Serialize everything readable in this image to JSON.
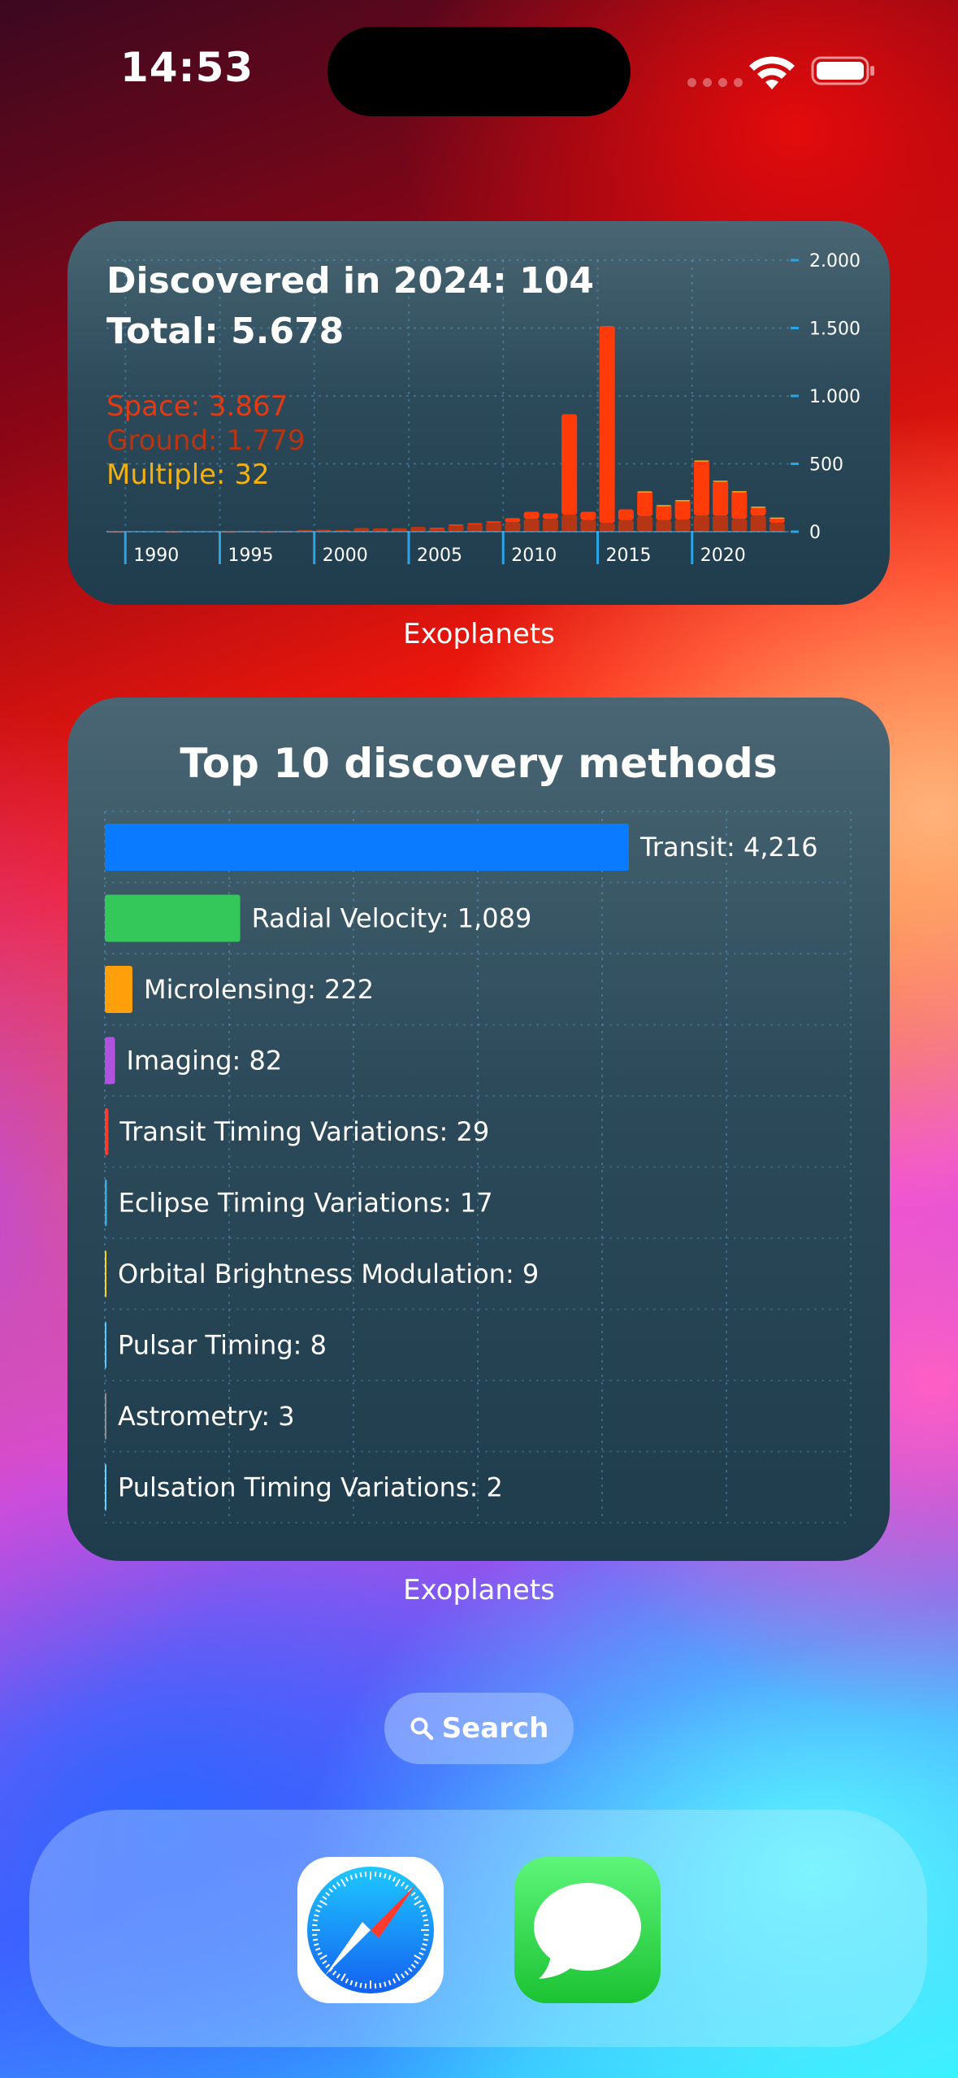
{
  "status_bar": {
    "time": "14:53"
  },
  "widget_top": {
    "line1": "Discovered in 2024: 104",
    "line2": "Total: 5.678",
    "space": "Space: 3.867",
    "ground": "Ground: 1.779",
    "multiple": "Multiple: 32",
    "label": "Exoplanets",
    "colors": {
      "space": "#ff3b0a",
      "ground": "#b53614",
      "multiple": "#f2b011"
    },
    "chart_data": {
      "type": "bar",
      "x": [
        1989,
        1990,
        1991,
        1992,
        1993,
        1994,
        1995,
        1996,
        1997,
        1998,
        1999,
        2000,
        2001,
        2002,
        2003,
        2004,
        2005,
        2006,
        2007,
        2008,
        2009,
        2010,
        2011,
        2012,
        2013,
        2014,
        2015,
        2016,
        2017,
        2018,
        2019,
        2020,
        2021,
        2022,
        2023,
        2024
      ],
      "series": [
        {
          "name": "Space",
          "values": [
            0,
            0,
            0,
            0,
            0,
            0,
            0,
            0,
            0,
            0,
            0,
            0,
            0,
            0,
            0,
            0,
            0,
            1,
            4,
            7,
            10,
            30,
            52,
            40,
            740,
            60,
            1450,
            80,
            180,
            110,
            140,
            400,
            250,
            200,
            60,
            35
          ]
        },
        {
          "name": "Ground",
          "values": [
            1,
            0,
            0,
            1,
            0,
            0,
            1,
            6,
            1,
            6,
            13,
            15,
            12,
            28,
            25,
            26,
            36,
            28,
            50,
            56,
            66,
            70,
            95,
            95,
            125,
            87,
            65,
            85,
            115,
            85,
            90,
            120,
            120,
            95,
            120,
            65
          ]
        },
        {
          "name": "Multiple",
          "values": [
            0,
            0,
            0,
            0,
            0,
            0,
            0,
            0,
            0,
            0,
            0,
            0,
            0,
            0,
            0,
            0,
            0,
            0,
            0,
            0,
            0,
            0,
            0,
            0,
            0,
            0,
            0,
            0,
            2,
            1,
            3,
            5,
            6,
            4,
            5,
            4
          ]
        }
      ],
      "x_ticks": [
        "1990",
        "1995",
        "2000",
        "2005",
        "2010",
        "2015",
        "2020"
      ],
      "y_ticks": [
        "2.000",
        "1.500",
        "1.000",
        "500",
        "0"
      ],
      "ylim": [
        0,
        2000
      ],
      "grid": true
    }
  },
  "widget_bottom": {
    "title": "Top 10 discovery methods",
    "label": "Exoplanets",
    "chart_data": {
      "type": "bar",
      "orientation": "horizontal",
      "categories": [
        "Transit",
        "Radial Velocity",
        "Microlensing",
        "Imaging",
        "Transit Timing Variations",
        "Eclipse Timing Variations",
        "Orbital Brightness Modulation",
        "Pulsar Timing",
        "Astrometry",
        "Pulsation Timing Variations"
      ],
      "values": [
        4216,
        1089,
        222,
        82,
        29,
        17,
        9,
        8,
        3,
        2
      ],
      "value_labels": [
        "Transit: 4,216",
        "Radial Velocity: 1,089",
        "Microlensing: 222",
        "Imaging: 82",
        "Transit Timing Variations: 29",
        "Eclipse Timing Variations: 17",
        "Orbital Brightness Modulation: 9",
        "Pulsar Timing: 8",
        "Astrometry: 3",
        "Pulsation Timing Variations: 2"
      ],
      "colors": [
        "#0a7bff",
        "#34c759",
        "#ff9f0a",
        "#af52de",
        "#ff3b30",
        "#32ade6",
        "#ffd60a",
        "#5ac8fa",
        "#8e8e93",
        "#64d2ff"
      ],
      "grid": true
    }
  },
  "search": {
    "label": "Search"
  },
  "dock": {
    "apps": [
      {
        "name": "Safari",
        "icon": "safari-compass-icon"
      },
      {
        "name": "Messages",
        "icon": "speech-bubble-icon"
      }
    ]
  }
}
